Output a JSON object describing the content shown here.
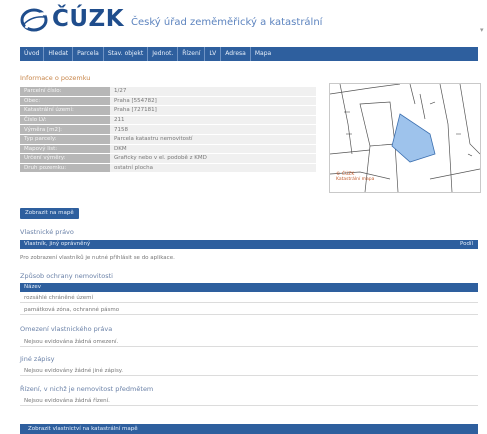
{
  "header": {
    "logo_text": "ČÚZK",
    "agency_name": "Český úřad zeměměřický a katastrální",
    "corner_mark": "▾",
    "logo_icon": "cuzk-logo-icon"
  },
  "nav": {
    "items": [
      "Úvod",
      "Hledat",
      "Parcela",
      "Stav. objekt",
      "Jednot.",
      "Řízení",
      "LV",
      "Adresa",
      "Mapa"
    ]
  },
  "parcel_info": {
    "title": "Informace o pozemku",
    "rows": [
      {
        "key": "Parcelní číslo:",
        "value": "1/27"
      },
      {
        "key": "Obec:",
        "value": "Praha [554782]"
      },
      {
        "key": "Katastrální území:",
        "value": "Praha [727181]"
      },
      {
        "key": "Číslo LV:",
        "value": "211"
      },
      {
        "key": "Výměra [m2]:",
        "value": "7158"
      },
      {
        "key": "Typ parcely:",
        "value": "Parcela katastru nemovitostí"
      },
      {
        "key": "Mapový list:",
        "value": "DKM"
      },
      {
        "key": "Určení výměry:",
        "value": "Graficky nebo v el. podobě z KMD"
      },
      {
        "key": "Druh pozemku:",
        "value": "ostatní plocha"
      }
    ]
  },
  "map": {
    "label_line1": "© ČÚZK",
    "label_line2": "Katastrální mapa",
    "highlight_color": "#9ec3ec"
  },
  "button": {
    "label": "Zobrazit na mapě"
  },
  "rights": {
    "title": "Vlastnické právo",
    "bar_label": "Vlastník, jiný oprávněný",
    "bar_right": "Podíl",
    "note": "Pro zobrazení vlastníků je nutné přihlásit se do aplikace."
  },
  "protection": {
    "title": "Způsob ochrany nemovitosti",
    "bar_label": "Název",
    "rows": [
      "rozsáhlé chráněné území",
      "památková zóna, ochranné pásmo"
    ]
  },
  "encumbrance": {
    "title": "Omezení vlastnického práva",
    "row": "Nejsou evidována žádná omezení."
  },
  "other_records": {
    "title": "Jiné zápisy",
    "row": "Nejsou evidovány žádné jiné zápisy."
  },
  "proceedings": {
    "title": "Řízení, v nichž je nemovitost předmětem",
    "row": "Nejsou evidována žádná řízení."
  },
  "footer": {
    "label": "Zobrazit vlastnictví na katastrální mapě"
  }
}
